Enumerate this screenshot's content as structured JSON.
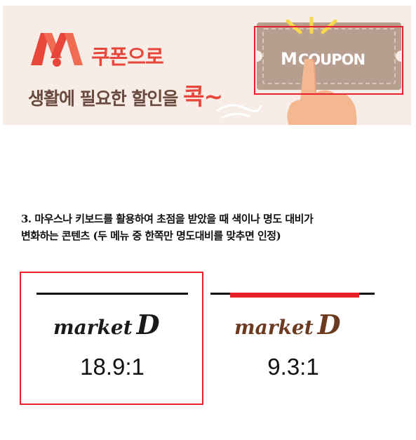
{
  "banner": {
    "logo_letter": "M",
    "line1": "쿠폰으로",
    "line2_main": "생활에 필요한 할인을 ",
    "line2_accent": "콕~",
    "coupon_letter": "M",
    "coupon_word": "COUPON",
    "colors": {
      "accent": "#e8463a",
      "coupon": "#b79e8e",
      "background": "#f7ece6"
    }
  },
  "description": {
    "line1": "3. 마우스나 키보드를 활용하여 초점을 받았을 때 색이나 명도 대비가",
    "line2": "변화하는 콘텐츠 (두 메뉴 중 한쪽만 명도대비를 맞추면 인정)"
  },
  "examples": [
    {
      "logo_word": "market",
      "logo_letter": "D",
      "ratio": "18.9:1",
      "color": "#1a1a1a",
      "focused": true
    },
    {
      "logo_word": "market",
      "logo_letter": "D",
      "ratio": "9.3:1",
      "color": "#6b3a1f",
      "focused": false
    }
  ],
  "colors": {
    "focus_border": "#e8212a",
    "text": "#111111"
  }
}
